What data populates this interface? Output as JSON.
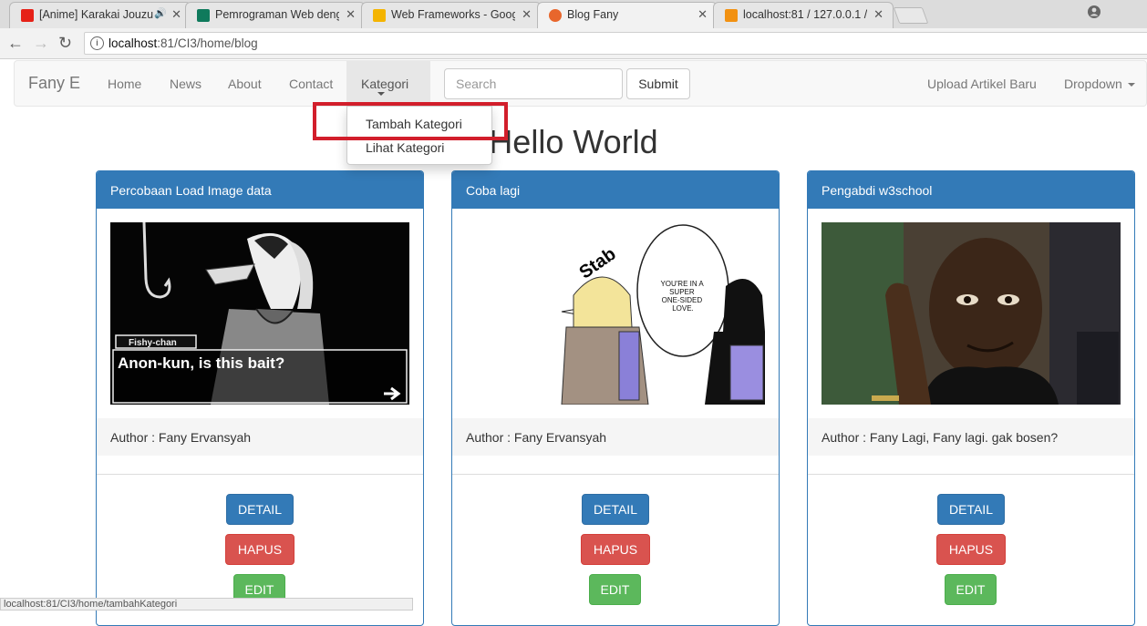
{
  "browser": {
    "tabs": [
      {
        "title": "[Anime] Karakai Jouzu",
        "favicon_color": "#e62117"
      },
      {
        "title": "Pemrograman Web deng",
        "favicon_color": "#0f7a5c"
      },
      {
        "title": "Web Frameworks - Goog",
        "favicon_color": "#f4b400"
      },
      {
        "title": "Blog Fany",
        "favicon_color": "#e8662c"
      },
      {
        "title": "localhost:81 / 127.0.0.1 /",
        "favicon_color": "#f29111"
      }
    ],
    "close_glyph": "✕",
    "url_host": "localhost",
    "url_rest": ":81/CI3/home/blog",
    "back_glyph": "←",
    "forward_glyph": "→",
    "reload_glyph": "↻",
    "info_glyph": "i"
  },
  "navbar": {
    "brand": "Fany E",
    "links": [
      "Home",
      "News",
      "About",
      "Contact"
    ],
    "kategori": "Kategori",
    "search_placeholder": "Search",
    "submit": "Submit",
    "upload": "Upload Artikel Baru",
    "dropdown": "Dropdown"
  },
  "kategori_menu": [
    "Tambah Kategori",
    "Lihat Kategori"
  ],
  "page_title": "Hello World",
  "posts": [
    {
      "title": "Percobaan Load Image data",
      "author": "Author : Fany Ervansyah",
      "image_caption_top": "Fishy-chan",
      "image_caption": "Anon-kun, is this bait?"
    },
    {
      "title": "Coba lagi",
      "author": "Author : Fany Ervansyah",
      "image_word": "Stab",
      "speech": [
        "YOU'RE IN A",
        "SUPER",
        "ONE-SIDED",
        "LOVE."
      ]
    },
    {
      "title": "Pengabdi w3school",
      "author": "Author : Fany Lagi, Fany lagi. gak bosen?"
    }
  ],
  "buttons": {
    "detail": "DETAIL",
    "hapus": "HAPUS",
    "edit": "EDIT"
  },
  "status_url": "localhost:81/CI3/home/tambahKategori"
}
